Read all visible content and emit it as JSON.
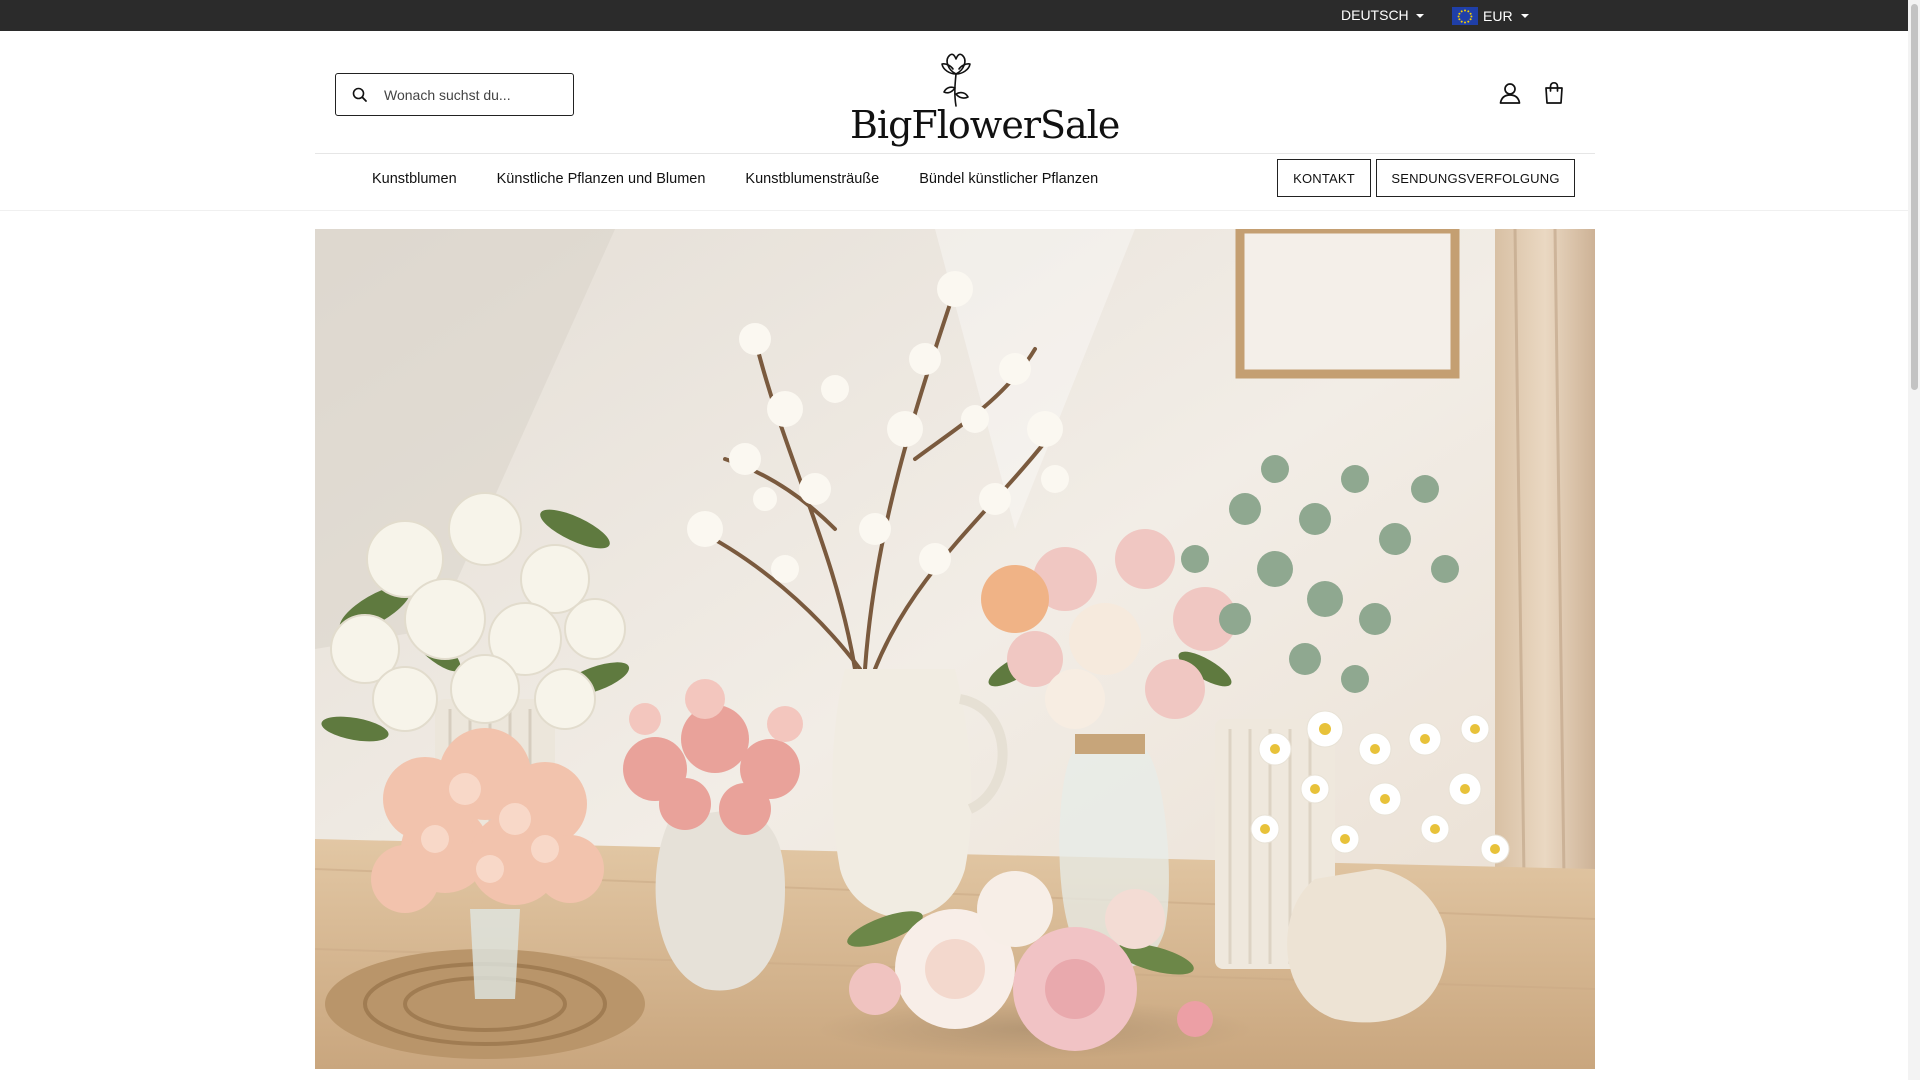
{
  "topbar": {
    "language": "DEUTSCH",
    "currency": "EUR",
    "currency_flag_icon": "eu-flag-icon"
  },
  "header": {
    "search": {
      "placeholder": "Wonach suchst du..."
    },
    "logo": {
      "text": "BigFlowerSale"
    },
    "icons": [
      "account-icon",
      "shopping-bag-icon"
    ]
  },
  "nav": {
    "items": [
      {
        "label": "Kunstblumen"
      },
      {
        "label": "Künstliche Pflanzen und Blumen"
      },
      {
        "label": "Kunstblumensträuße"
      },
      {
        "label": "Bündel künstlicher Pflanzen"
      }
    ],
    "contact_label": "KONTAKT",
    "tracking_label": "SENDUNGSVERFOLGUNG"
  },
  "colors": {
    "topbar": "#2b2b2b",
    "text": "#111111",
    "hero_wall": "#ece6dc",
    "hero_table": "#d9b993"
  }
}
